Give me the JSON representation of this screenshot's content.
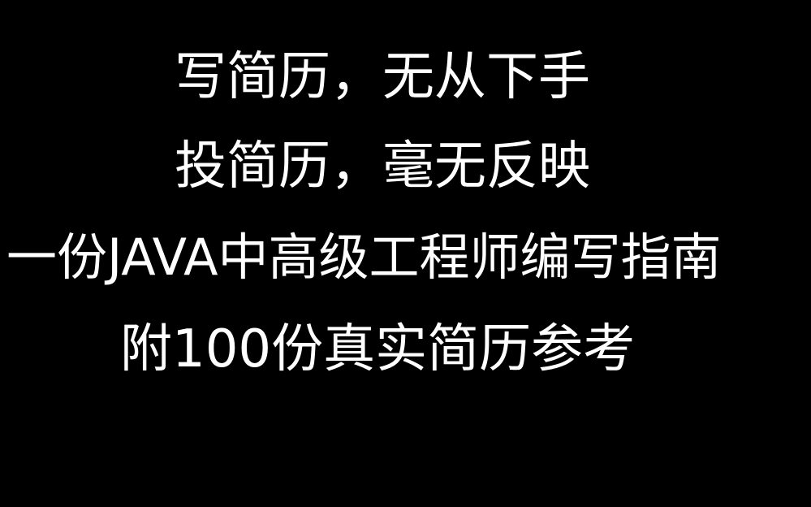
{
  "lines": [
    "写简历，无从下手",
    "投简历，毫无反映",
    "一份JAVA中高级工程师编写指南",
    "附100份真实简历参考"
  ],
  "colors": {
    "background": "#000000",
    "text": "#ffffff"
  }
}
